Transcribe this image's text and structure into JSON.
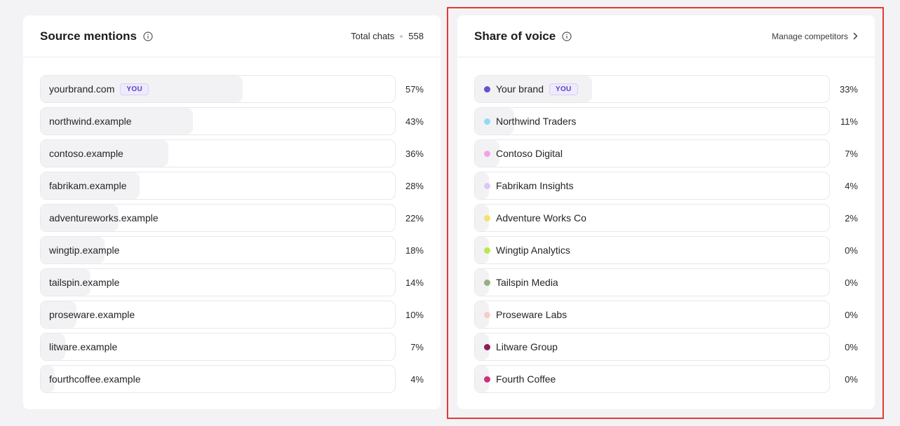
{
  "source_mentions": {
    "title": "Source mentions",
    "total_label": "Total chats",
    "total_value": "558",
    "you_badge": "YOU",
    "items": [
      {
        "label": "yourbrand.com",
        "pct": "57%",
        "value": 57,
        "you": true
      },
      {
        "label": "northwind.example",
        "pct": "43%",
        "value": 43
      },
      {
        "label": "contoso.example",
        "pct": "36%",
        "value": 36
      },
      {
        "label": "fabrikam.example",
        "pct": "28%",
        "value": 28
      },
      {
        "label": "adventureworks.example",
        "pct": "22%",
        "value": 22
      },
      {
        "label": "wingtip.example",
        "pct": "18%",
        "value": 18
      },
      {
        "label": "tailspin.example",
        "pct": "14%",
        "value": 14
      },
      {
        "label": "proseware.example",
        "pct": "10%",
        "value": 10
      },
      {
        "label": "litware.example",
        "pct": "7%",
        "value": 7
      },
      {
        "label": "fourthcoffee.example",
        "pct": "4%",
        "value": 4
      }
    ]
  },
  "share_of_voice": {
    "title": "Share of voice",
    "manage_label": "Manage competitors",
    "you_badge": "YOU",
    "items": [
      {
        "label": "Your brand",
        "pct": "33%",
        "value": 33,
        "color": "#6a4fd0",
        "you": true
      },
      {
        "label": "Northwind Traders",
        "pct": "11%",
        "value": 11,
        "color": "#8fdcf3"
      },
      {
        "label": "Contoso Digital",
        "pct": "7%",
        "value": 7,
        "color": "#f3a3e8"
      },
      {
        "label": "Fabrikam Insights",
        "pct": "4%",
        "value": 4,
        "color": "#dcc8f7"
      },
      {
        "label": "Adventure Works Co",
        "pct": "2%",
        "value": 2,
        "color": "#f5e06b"
      },
      {
        "label": "Wingtip Analytics",
        "pct": "0%",
        "value": 0,
        "color": "#b9e84a"
      },
      {
        "label": "Tailspin Media",
        "pct": "0%",
        "value": 0,
        "color": "#94b07f"
      },
      {
        "label": "Proseware Labs",
        "pct": "0%",
        "value": 0,
        "color": "#f8cdc5"
      },
      {
        "label": "Litware Group",
        "pct": "0%",
        "value": 0,
        "color": "#8e1b5e"
      },
      {
        "label": "Fourth Coffee",
        "pct": "0%",
        "value": 0,
        "color": "#cd2f81"
      }
    ]
  }
}
